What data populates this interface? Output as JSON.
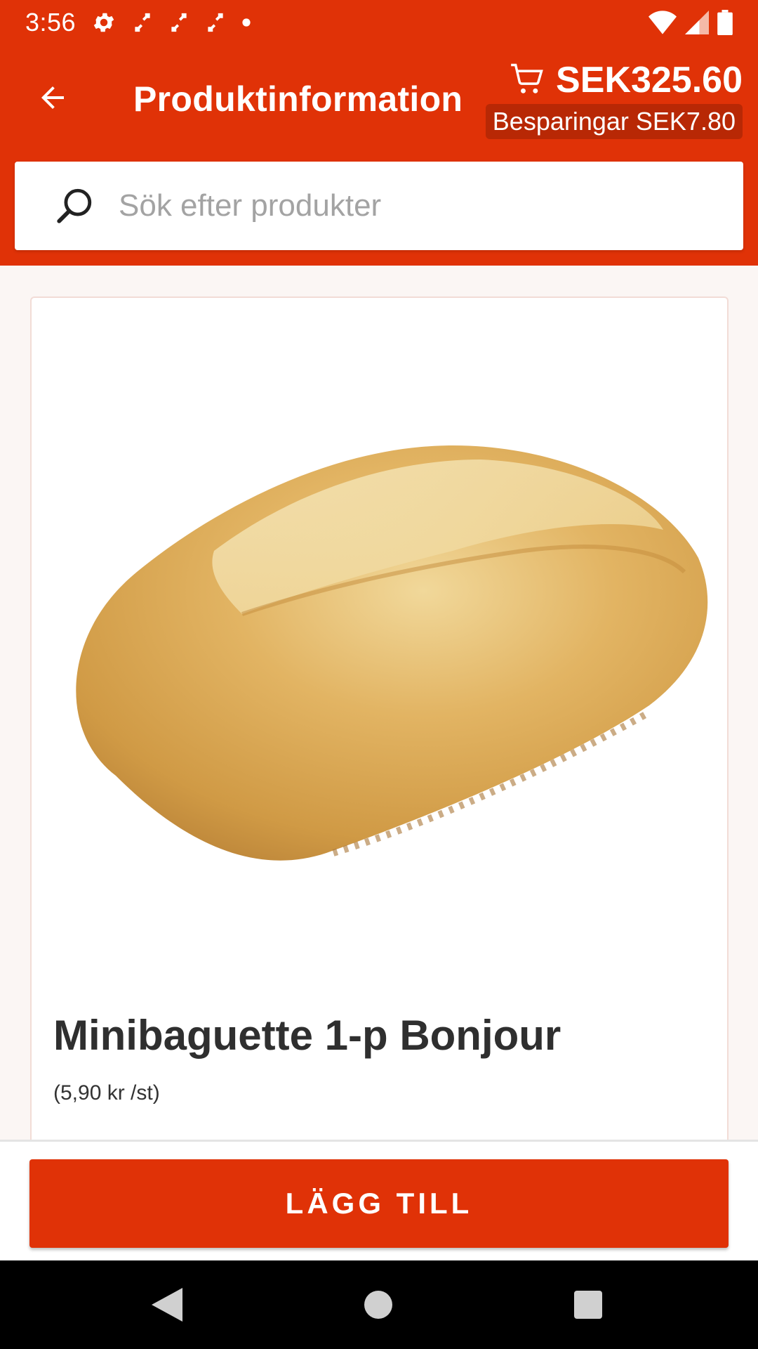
{
  "status_bar": {
    "time": "3:56",
    "left_icons": [
      "settings-icon",
      "expand-icon",
      "expand-icon",
      "expand-icon",
      "dot-icon"
    ],
    "right_icons": [
      "wifi-icon",
      "signal-icon",
      "battery-icon"
    ]
  },
  "toolbar": {
    "title": "Produktinformation",
    "cart_total": "SEK325.60",
    "savings": "Besparingar SEK7.80",
    "background_color": "#e03207"
  },
  "search": {
    "placeholder": "Sök efter produkter",
    "value": ""
  },
  "product": {
    "name": "Minibaguette 1-p Bonjour",
    "unit_price": "(5,90 kr /st)",
    "image_icon": "bread-roll-image"
  },
  "actions": {
    "add_label": "LÄGG TILL",
    "accent_color": "#e03207"
  },
  "nav_bar": {
    "buttons": [
      "back-triangle-icon",
      "home-circle-icon",
      "recents-square-icon"
    ]
  }
}
